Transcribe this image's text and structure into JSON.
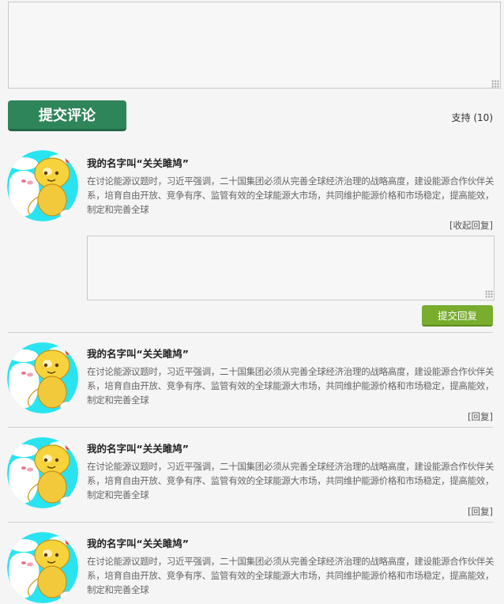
{
  "composer": {
    "value": "",
    "submit_label": "提交评论",
    "support_label": "支持 (10)"
  },
  "colors": {
    "submit_button": "#2f855a",
    "reply_button": "#78ad2e",
    "avatar_bg": "#29e4f0"
  },
  "comments": [
    {
      "name": "我的名字叫“关关雎鸠”",
      "text": "在讨论能源议题时，习近平强调，二十国集团必须从完善全球经济治理的战略高度，建设能源合作伙伴关系，培育自由开放、竞争有序、监管有效的全球能源大市场，共同维护能源价格和市场稳定，提高能效，制定和完善全球",
      "action": "[收起回复]",
      "reply_value": "",
      "reply_submit": "提交回复"
    },
    {
      "name": "我的名字叫“关关雎鸠”",
      "text": "在讨论能源议题时，习近平强调，二十国集团必须从完善全球经济治理的战略高度，建设能源合作伙伴关系，培育自由开放、竞争有序、监管有效的全球能源大市场，共同维护能源价格和市场稳定，提高能效，制定和完善全球",
      "action": "[回复]"
    },
    {
      "name": "我的名字叫“关关雎鸠”",
      "text": "在讨论能源议题时，习近平强调，二十国集团必须从完善全球经济治理的战略高度，建设能源合作伙伴关系，培育自由开放、竞争有序、监管有效的全球能源大市场，共同维护能源价格和市场稳定，提高能效，制定和完善全球",
      "action": "[回复]"
    },
    {
      "name": "我的名字叫“关关雎鸠”",
      "text": "在讨论能源议题时，习近平强调，二十国集团必须从完善全球经济治理的战略高度，建设能源合作伙伴关系，培育自由开放、竞争有序、监管有效的全球能源大市场，共同维护能源价格和市场稳定，提高能效，制定和完善全球"
    }
  ]
}
